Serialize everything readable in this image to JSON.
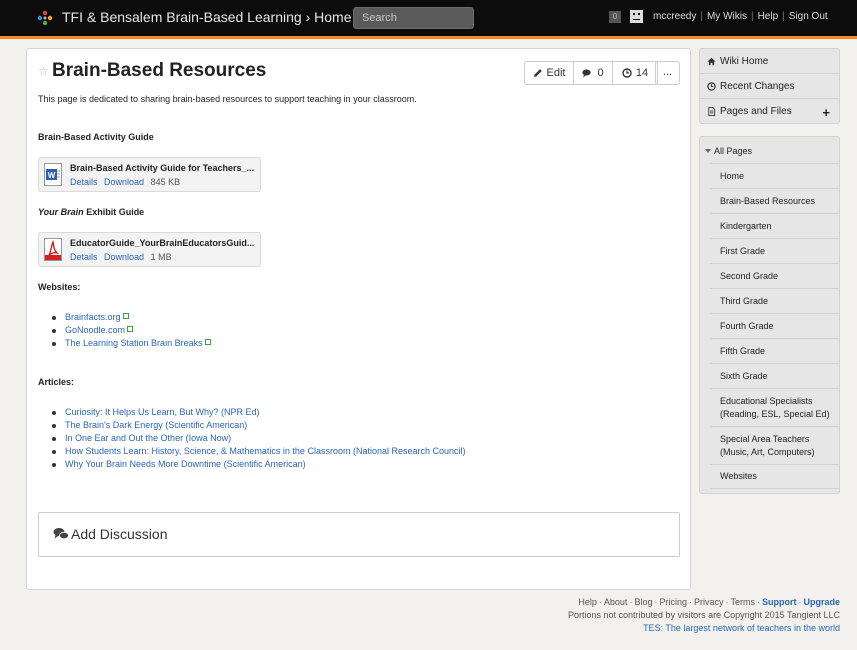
{
  "topbar": {
    "site_title": "TFI & Bensalem Brain-Based Learning",
    "breadcrumb_sep": "›",
    "breadcrumb_page": "Home",
    "search_placeholder": "Search",
    "notification_count": "0",
    "username": "mccreedy",
    "links": [
      "My Wikis",
      "Help",
      "Sign Out"
    ],
    "accent_color": "#f58a1f"
  },
  "page": {
    "title": "Brain-Based Resources",
    "actions": {
      "edit_label": "Edit",
      "comments_count": "0",
      "history_count": "14",
      "more_label": "..."
    },
    "intro": "This page is dedicated to sharing brain-based resources to support teaching in your classroom.",
    "activity_heading": "Brain-Based Activity Guide",
    "exhibit_heading_em": "Your Brain",
    "exhibit_heading_rest": " Exhibit Guide",
    "files": [
      {
        "name": "Brain-Based Activity Guide for Teachers_...",
        "details": "Details",
        "download": "Download",
        "size": "845 KB",
        "icon": "word-doc-icon"
      },
      {
        "name": "EducatorGuide_YourBrainEducatorsGuid...",
        "details": "Details",
        "download": "Download",
        "size": "1 MB",
        "icon": "pdf-icon"
      }
    ],
    "websites_heading": "Websites:",
    "websites": [
      "Brainfacts.org",
      "GoNoodle.com",
      "The Learning Station Brain Breaks"
    ],
    "articles_heading": "Articles:",
    "articles": [
      "Curiosity: It Helps Us Learn, But Why? (NPR Ed)",
      "The Brain's Dark Energy (Scientific American)",
      "In One Ear and Out the Other (Iowa Now)",
      "How Students Learn: History, Science, & Mathematics in the Classroom (National Research Council)",
      "Why Your Brain Needs More Downtime (Scientific American)"
    ],
    "discussion_label": "Add Discussion"
  },
  "sidebar": {
    "top": [
      {
        "label": "Wiki Home",
        "icon": "home-icon"
      },
      {
        "label": "Recent Changes",
        "icon": "clock-icon"
      },
      {
        "label": "Pages and Files",
        "icon": "file-icon"
      }
    ],
    "add_label": "+",
    "nav_heading": "All Pages",
    "nav_items": [
      "Home",
      "Brain-Based Resources",
      "Kindergarten",
      "First Grade",
      "Second Grade",
      "Third Grade",
      "Fourth Grade",
      "Fifth Grade",
      "Sixth Grade",
      "Educational Specialists (Reading, ESL, Special Ed)",
      "Special Area Teachers (Music, Art, Computers)",
      "Websites"
    ]
  },
  "footer": {
    "links": [
      "Help",
      "About",
      "Blog",
      "Pricing",
      "Privacy",
      "Terms"
    ],
    "bold_links": [
      "Support",
      "Upgrade"
    ],
    "copyright": "Portions not contributed by visitors are Copyright 2015 Tangient LLC",
    "tes_line": "TES: The largest network of teachers in the world"
  }
}
